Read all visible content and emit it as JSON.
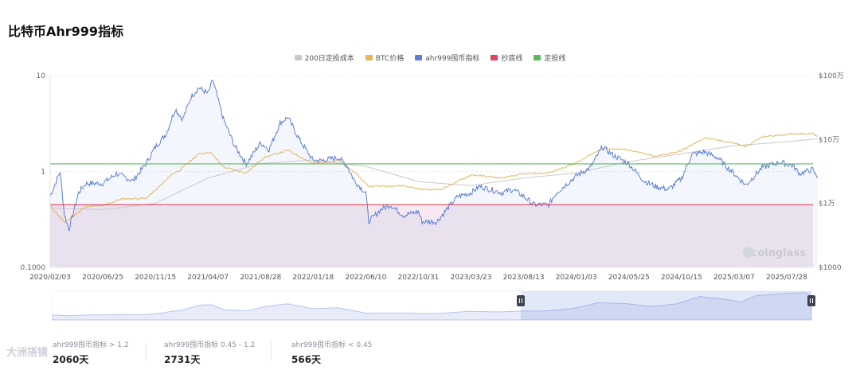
{
  "page": {
    "title": "比特币Ahr999指标"
  },
  "legend": [
    {
      "label": "200日定投成本",
      "color": "#c9c9c9"
    },
    {
      "label": "BTC价格",
      "color": "#e2b65a"
    },
    {
      "label": "ahr999囤币指标",
      "color": "#5b7fd9"
    },
    {
      "label": "抄底线",
      "color": "#e0445e"
    },
    {
      "label": "定投线",
      "color": "#5cba5c"
    }
  ],
  "chart_data": {
    "type": "line",
    "x_ticks": [
      "2020/02/03",
      "2020/06/25",
      "2020/11/15",
      "2021/04/07",
      "2021/08/28",
      "2022/01/18",
      "2022/06/10",
      "2022/10/31",
      "2023/03/23",
      "2023/08/13",
      "2024/01/03",
      "2024/05/25",
      "2024/10/15",
      "2025/03/07",
      "2025/07/28"
    ],
    "y_left": {
      "scale": "log",
      "ticks": [
        "10",
        "1",
        "0.1000"
      ],
      "range": [
        0.1,
        10
      ]
    },
    "y_right": {
      "scale": "log",
      "ticks": [
        "$100万",
        "$10万",
        "$1万",
        "$1000"
      ],
      "range": [
        1000,
        1000000
      ]
    },
    "series": [
      {
        "name": "ahr999囤币指标",
        "axis": "left",
        "points": [
          [
            "2020/02/03",
            0.55
          ],
          [
            "2020/03/01",
            1.0
          ],
          [
            "2020/03/13",
            0.35
          ],
          [
            "2020/03/25",
            0.25
          ],
          [
            "2020/04/20",
            0.6
          ],
          [
            "2020/05/10",
            0.75
          ],
          [
            "2020/06/25",
            0.75
          ],
          [
            "2020/08/01",
            0.95
          ],
          [
            "2020/09/15",
            0.8
          ],
          [
            "2020/10/20",
            1.2
          ],
          [
            "2020/11/15",
            1.8
          ],
          [
            "2020/12/15",
            2.5
          ],
          [
            "2021/01/08",
            4.5
          ],
          [
            "2021/01/28",
            3.5
          ],
          [
            "2021/02/20",
            6.0
          ],
          [
            "2021/03/13",
            7.5
          ],
          [
            "2021/04/07",
            6.5
          ],
          [
            "2021/04/20",
            9.0
          ],
          [
            "2021/05/19",
            3.5
          ],
          [
            "2021/06/20",
            1.8
          ],
          [
            "2021/07/20",
            1.2
          ],
          [
            "2021/08/28",
            2.0
          ],
          [
            "2021/09/20",
            1.7
          ],
          [
            "2021/10/20",
            3.2
          ],
          [
            "2021/11/10",
            3.7
          ],
          [
            "2021/12/10",
            2.2
          ],
          [
            "2022/01/18",
            1.3
          ],
          [
            "2022/02/10",
            1.3
          ],
          [
            "2022/03/28",
            1.4
          ],
          [
            "2022/04/20",
            1.15
          ],
          [
            "2022/05/10",
            0.8
          ],
          [
            "2022/06/10",
            0.6
          ],
          [
            "2022/06/18",
            0.3
          ],
          [
            "2022/07/20",
            0.4
          ],
          [
            "2022/08/15",
            0.45
          ],
          [
            "2022/09/20",
            0.35
          ],
          [
            "2022/10/31",
            0.38
          ],
          [
            "2022/11/10",
            0.3
          ],
          [
            "2022/12/20",
            0.3
          ],
          [
            "2023/01/20",
            0.42
          ],
          [
            "2023/02/15",
            0.55
          ],
          [
            "2023/03/23",
            0.6
          ],
          [
            "2023/04/15",
            0.7
          ],
          [
            "2023/06/15",
            0.6
          ],
          [
            "2023/07/15",
            0.65
          ],
          [
            "2023/08/13",
            0.55
          ],
          [
            "2023/09/10",
            0.45
          ],
          [
            "2023/10/20",
            0.45
          ],
          [
            "2023/11/10",
            0.6
          ],
          [
            "2024/01/03",
            0.9
          ],
          [
            "2024/02/10",
            1.1
          ],
          [
            "2024/03/14",
            1.8
          ],
          [
            "2024/04/10",
            1.5
          ],
          [
            "2024/05/25",
            1.2
          ],
          [
            "2024/07/05",
            0.8
          ],
          [
            "2024/08/05",
            0.7
          ],
          [
            "2024/09/10",
            0.65
          ],
          [
            "2024/10/15",
            0.85
          ],
          [
            "2024/11/12",
            1.5
          ],
          [
            "2024/12/17",
            1.6
          ],
          [
            "2025/01/20",
            1.4
          ],
          [
            "2025/03/07",
            0.95
          ],
          [
            "2025/04/08",
            0.72
          ],
          [
            "2025/05/22",
            1.1
          ],
          [
            "2025/07/10",
            1.25
          ],
          [
            "2025/07/28",
            1.2
          ],
          [
            "2025/08/14",
            1.15
          ],
          [
            "2025/09/01",
            0.95
          ],
          [
            "2025/10/06",
            1.05
          ],
          [
            "2025/10/20",
            0.85
          ]
        ]
      },
      {
        "name": "BTC价格",
        "axis": "right",
        "points": [
          [
            "2020/02/03",
            9300
          ],
          [
            "2020/03/13",
            5000
          ],
          [
            "2020/05/10",
            9000
          ],
          [
            "2020/06/25",
            9200
          ],
          [
            "2020/08/15",
            11800
          ],
          [
            "2020/10/20",
            12000
          ],
          [
            "2020/11/15",
            16000
          ],
          [
            "2020/12/31",
            29000
          ],
          [
            "2021/01/20",
            33000
          ],
          [
            "2021/03/13",
            60000
          ],
          [
            "2021/04/14",
            63000
          ],
          [
            "2021/05/19",
            37000
          ],
          [
            "2021/07/20",
            30000
          ],
          [
            "2021/09/06",
            52000
          ],
          [
            "2021/11/10",
            68000
          ],
          [
            "2022/01/18",
            42000
          ],
          [
            "2022/03/28",
            47000
          ],
          [
            "2022/05/10",
            31000
          ],
          [
            "2022/06/18",
            18500
          ],
          [
            "2022/09/20",
            19000
          ],
          [
            "2022/11/10",
            16500
          ],
          [
            "2022/12/31",
            16500
          ],
          [
            "2023/03/23",
            28000
          ],
          [
            "2023/06/15",
            25000
          ],
          [
            "2023/08/13",
            29000
          ],
          [
            "2023/10/20",
            30000
          ],
          [
            "2024/01/03",
            43000
          ],
          [
            "2024/03/14",
            73000
          ],
          [
            "2024/05/25",
            69000
          ],
          [
            "2024/08/05",
            54000
          ],
          [
            "2024/10/15",
            67000
          ],
          [
            "2024/12/17",
            106000
          ],
          [
            "2025/03/07",
            88000
          ],
          [
            "2025/04/08",
            77000
          ],
          [
            "2025/05/22",
            110000
          ],
          [
            "2025/08/14",
            123000
          ],
          [
            "2025/10/06",
            125000
          ],
          [
            "2025/10/20",
            110000
          ]
        ]
      },
      {
        "name": "200日定投成本",
        "axis": "right",
        "points": [
          [
            "2020/02/03",
            8500
          ],
          [
            "2020/06/25",
            8000
          ],
          [
            "2020/11/15",
            10000
          ],
          [
            "2021/04/07",
            25000
          ],
          [
            "2021/08/28",
            42000
          ],
          [
            "2022/01/18",
            48000
          ],
          [
            "2022/06/10",
            38000
          ],
          [
            "2022/10/31",
            22000
          ],
          [
            "2023/03/23",
            19000
          ],
          [
            "2023/08/13",
            25000
          ],
          [
            "2024/01/03",
            30000
          ],
          [
            "2024/05/25",
            45000
          ],
          [
            "2024/10/15",
            60000
          ],
          [
            "2025/03/07",
            80000
          ],
          [
            "2025/07/28",
            92000
          ],
          [
            "2025/10/20",
            103000
          ]
        ]
      }
    ],
    "reference_lines": [
      {
        "name": "抄底线",
        "value": 0.45
      },
      {
        "name": "定投线",
        "value": 1.2
      }
    ],
    "navigator": {
      "selected_from": "2023/08/13",
      "selected_to": "2025/10/20"
    }
  },
  "watermark": {
    "brand": "coinglass",
    "corner": "大洲搭镜"
  },
  "stats": [
    {
      "label": "ahr999囤币指标 > 1.2",
      "value": "2060天"
    },
    {
      "label": "ahr999囤币指标 0.45 - 1.2",
      "value": "2731天"
    },
    {
      "label": "ahr999囤币指标 < 0.45",
      "value": "566天"
    }
  ]
}
